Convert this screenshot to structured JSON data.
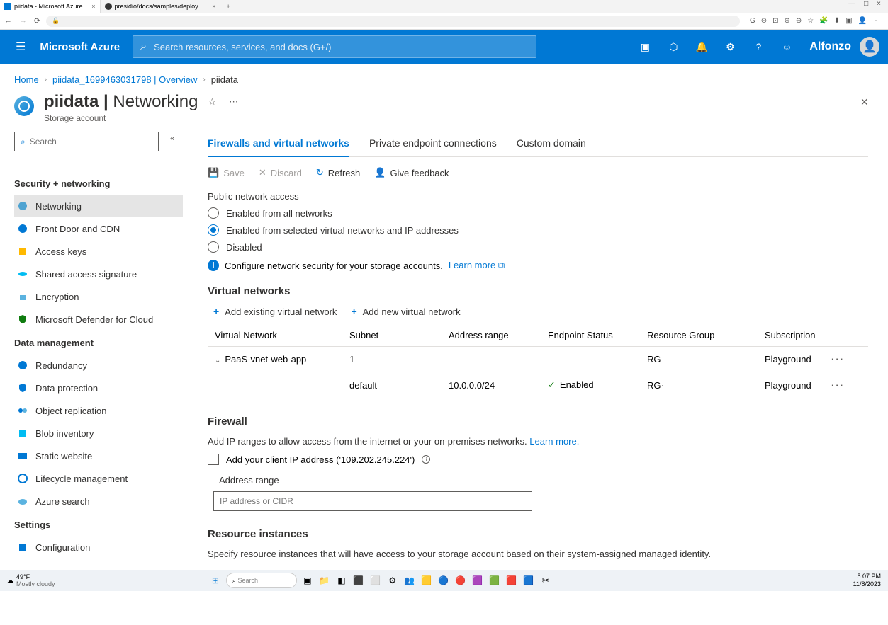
{
  "browser": {
    "tab1": "piidata - Microsoft Azure",
    "tab2": "presidio/docs/samples/deploy...",
    "min": "—",
    "max": "□",
    "close": "×"
  },
  "azure": {
    "brand": "Microsoft Azure",
    "search_placeholder": "Search resources, services, and docs (G+/)",
    "user": "Alfonzo"
  },
  "breadcrumb": {
    "home": "Home",
    "rg": "piidata_1699463031798 | Overview",
    "current": "piidata"
  },
  "page": {
    "title_res": "piidata",
    "title_sep": " | ",
    "title_section": "Networking",
    "subtitle": "Storage account"
  },
  "sidebar": {
    "search_placeholder": "Search",
    "sec_security": "Security + networking",
    "networking": "Networking",
    "frontdoor": "Front Door and CDN",
    "accesskeys": "Access keys",
    "sas": "Shared access signature",
    "encryption": "Encryption",
    "defender": "Microsoft Defender for Cloud",
    "sec_data": "Data management",
    "redundancy": "Redundancy",
    "dataprotection": "Data protection",
    "objrep": "Object replication",
    "blobinv": "Blob inventory",
    "staticweb": "Static website",
    "lifecycle": "Lifecycle management",
    "azsearch": "Azure search",
    "sec_settings": "Settings",
    "config": "Configuration"
  },
  "tabs": {
    "firewall": "Firewalls and virtual networks",
    "pe": "Private endpoint connections",
    "custom": "Custom domain"
  },
  "toolbar": {
    "save": "Save",
    "discard": "Discard",
    "refresh": "Refresh",
    "feedback": "Give feedback"
  },
  "pna": {
    "label": "Public network access",
    "opt1": "Enabled from all networks",
    "opt2": "Enabled from selected virtual networks and IP addresses",
    "opt3": "Disabled",
    "info": "Configure network security for your storage accounts.",
    "learn": "Learn more"
  },
  "vnet": {
    "title": "Virtual networks",
    "add_existing": "Add existing virtual network",
    "add_new": "Add new virtual network",
    "h_vn": "Virtual Network",
    "h_sub": "Subnet",
    "h_addr": "Address range",
    "h_ep": "Endpoint Status",
    "h_rg": "Resource Group",
    "h_subsc": "Subscription",
    "r1_name": "PaaS-vnet-web-app",
    "r1_sub": "1",
    "r1_rg": "RG",
    "r1_subsc": "Playground",
    "r2_sub": "default",
    "r2_addr": "10.0.0.0/24",
    "r2_ep": "Enabled",
    "r2_rg": "RG·",
    "r2_subsc": "Playground"
  },
  "firewall": {
    "title": "Firewall",
    "desc": "Add IP ranges to allow access from the internet or your on-premises networks. ",
    "learn": "Learn more.",
    "addclient": "Add your client IP address ('109.202.245.224')",
    "col_addr": "Address range",
    "placeholder": "IP address or CIDR"
  },
  "ri": {
    "title": "Resource instances",
    "desc": "Specify resource instances that will have access to your storage account based on their system-assigned managed identity."
  },
  "taskbar": {
    "temp": "49°F",
    "cond": "Mostly cloudy",
    "search": "Search",
    "time": "5:07 PM",
    "date": "11/8/2023"
  }
}
